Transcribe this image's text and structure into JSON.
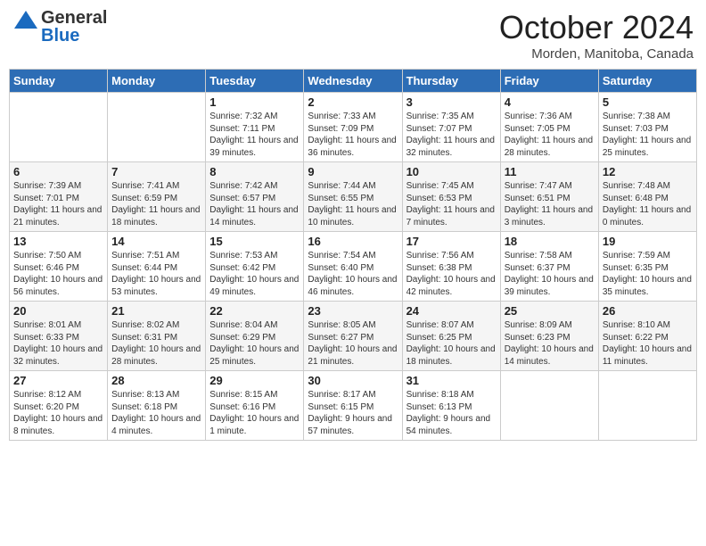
{
  "header": {
    "logo": {
      "line1": "General",
      "line2": "Blue"
    },
    "title": "October 2024",
    "location": "Morden, Manitoba, Canada"
  },
  "weekdays": [
    "Sunday",
    "Monday",
    "Tuesday",
    "Wednesday",
    "Thursday",
    "Friday",
    "Saturday"
  ],
  "weeks": [
    [
      {
        "day": "",
        "sunrise": "",
        "sunset": "",
        "daylight": ""
      },
      {
        "day": "",
        "sunrise": "",
        "sunset": "",
        "daylight": ""
      },
      {
        "day": "1",
        "sunrise": "Sunrise: 7:32 AM",
        "sunset": "Sunset: 7:11 PM",
        "daylight": "Daylight: 11 hours and 39 minutes."
      },
      {
        "day": "2",
        "sunrise": "Sunrise: 7:33 AM",
        "sunset": "Sunset: 7:09 PM",
        "daylight": "Daylight: 11 hours and 36 minutes."
      },
      {
        "day": "3",
        "sunrise": "Sunrise: 7:35 AM",
        "sunset": "Sunset: 7:07 PM",
        "daylight": "Daylight: 11 hours and 32 minutes."
      },
      {
        "day": "4",
        "sunrise": "Sunrise: 7:36 AM",
        "sunset": "Sunset: 7:05 PM",
        "daylight": "Daylight: 11 hours and 28 minutes."
      },
      {
        "day": "5",
        "sunrise": "Sunrise: 7:38 AM",
        "sunset": "Sunset: 7:03 PM",
        "daylight": "Daylight: 11 hours and 25 minutes."
      }
    ],
    [
      {
        "day": "6",
        "sunrise": "Sunrise: 7:39 AM",
        "sunset": "Sunset: 7:01 PM",
        "daylight": "Daylight: 11 hours and 21 minutes."
      },
      {
        "day": "7",
        "sunrise": "Sunrise: 7:41 AM",
        "sunset": "Sunset: 6:59 PM",
        "daylight": "Daylight: 11 hours and 18 minutes."
      },
      {
        "day": "8",
        "sunrise": "Sunrise: 7:42 AM",
        "sunset": "Sunset: 6:57 PM",
        "daylight": "Daylight: 11 hours and 14 minutes."
      },
      {
        "day": "9",
        "sunrise": "Sunrise: 7:44 AM",
        "sunset": "Sunset: 6:55 PM",
        "daylight": "Daylight: 11 hours and 10 minutes."
      },
      {
        "day": "10",
        "sunrise": "Sunrise: 7:45 AM",
        "sunset": "Sunset: 6:53 PM",
        "daylight": "Daylight: 11 hours and 7 minutes."
      },
      {
        "day": "11",
        "sunrise": "Sunrise: 7:47 AM",
        "sunset": "Sunset: 6:51 PM",
        "daylight": "Daylight: 11 hours and 3 minutes."
      },
      {
        "day": "12",
        "sunrise": "Sunrise: 7:48 AM",
        "sunset": "Sunset: 6:48 PM",
        "daylight": "Daylight: 11 hours and 0 minutes."
      }
    ],
    [
      {
        "day": "13",
        "sunrise": "Sunrise: 7:50 AM",
        "sunset": "Sunset: 6:46 PM",
        "daylight": "Daylight: 10 hours and 56 minutes."
      },
      {
        "day": "14",
        "sunrise": "Sunrise: 7:51 AM",
        "sunset": "Sunset: 6:44 PM",
        "daylight": "Daylight: 10 hours and 53 minutes."
      },
      {
        "day": "15",
        "sunrise": "Sunrise: 7:53 AM",
        "sunset": "Sunset: 6:42 PM",
        "daylight": "Daylight: 10 hours and 49 minutes."
      },
      {
        "day": "16",
        "sunrise": "Sunrise: 7:54 AM",
        "sunset": "Sunset: 6:40 PM",
        "daylight": "Daylight: 10 hours and 46 minutes."
      },
      {
        "day": "17",
        "sunrise": "Sunrise: 7:56 AM",
        "sunset": "Sunset: 6:38 PM",
        "daylight": "Daylight: 10 hours and 42 minutes."
      },
      {
        "day": "18",
        "sunrise": "Sunrise: 7:58 AM",
        "sunset": "Sunset: 6:37 PM",
        "daylight": "Daylight: 10 hours and 39 minutes."
      },
      {
        "day": "19",
        "sunrise": "Sunrise: 7:59 AM",
        "sunset": "Sunset: 6:35 PM",
        "daylight": "Daylight: 10 hours and 35 minutes."
      }
    ],
    [
      {
        "day": "20",
        "sunrise": "Sunrise: 8:01 AM",
        "sunset": "Sunset: 6:33 PM",
        "daylight": "Daylight: 10 hours and 32 minutes."
      },
      {
        "day": "21",
        "sunrise": "Sunrise: 8:02 AM",
        "sunset": "Sunset: 6:31 PM",
        "daylight": "Daylight: 10 hours and 28 minutes."
      },
      {
        "day": "22",
        "sunrise": "Sunrise: 8:04 AM",
        "sunset": "Sunset: 6:29 PM",
        "daylight": "Daylight: 10 hours and 25 minutes."
      },
      {
        "day": "23",
        "sunrise": "Sunrise: 8:05 AM",
        "sunset": "Sunset: 6:27 PM",
        "daylight": "Daylight: 10 hours and 21 minutes."
      },
      {
        "day": "24",
        "sunrise": "Sunrise: 8:07 AM",
        "sunset": "Sunset: 6:25 PM",
        "daylight": "Daylight: 10 hours and 18 minutes."
      },
      {
        "day": "25",
        "sunrise": "Sunrise: 8:09 AM",
        "sunset": "Sunset: 6:23 PM",
        "daylight": "Daylight: 10 hours and 14 minutes."
      },
      {
        "day": "26",
        "sunrise": "Sunrise: 8:10 AM",
        "sunset": "Sunset: 6:22 PM",
        "daylight": "Daylight: 10 hours and 11 minutes."
      }
    ],
    [
      {
        "day": "27",
        "sunrise": "Sunrise: 8:12 AM",
        "sunset": "Sunset: 6:20 PM",
        "daylight": "Daylight: 10 hours and 8 minutes."
      },
      {
        "day": "28",
        "sunrise": "Sunrise: 8:13 AM",
        "sunset": "Sunset: 6:18 PM",
        "daylight": "Daylight: 10 hours and 4 minutes."
      },
      {
        "day": "29",
        "sunrise": "Sunrise: 8:15 AM",
        "sunset": "Sunset: 6:16 PM",
        "daylight": "Daylight: 10 hours and 1 minute."
      },
      {
        "day": "30",
        "sunrise": "Sunrise: 8:17 AM",
        "sunset": "Sunset: 6:15 PM",
        "daylight": "Daylight: 9 hours and 57 minutes."
      },
      {
        "day": "31",
        "sunrise": "Sunrise: 8:18 AM",
        "sunset": "Sunset: 6:13 PM",
        "daylight": "Daylight: 9 hours and 54 minutes."
      },
      {
        "day": "",
        "sunrise": "",
        "sunset": "",
        "daylight": ""
      },
      {
        "day": "",
        "sunrise": "",
        "sunset": "",
        "daylight": ""
      }
    ]
  ]
}
